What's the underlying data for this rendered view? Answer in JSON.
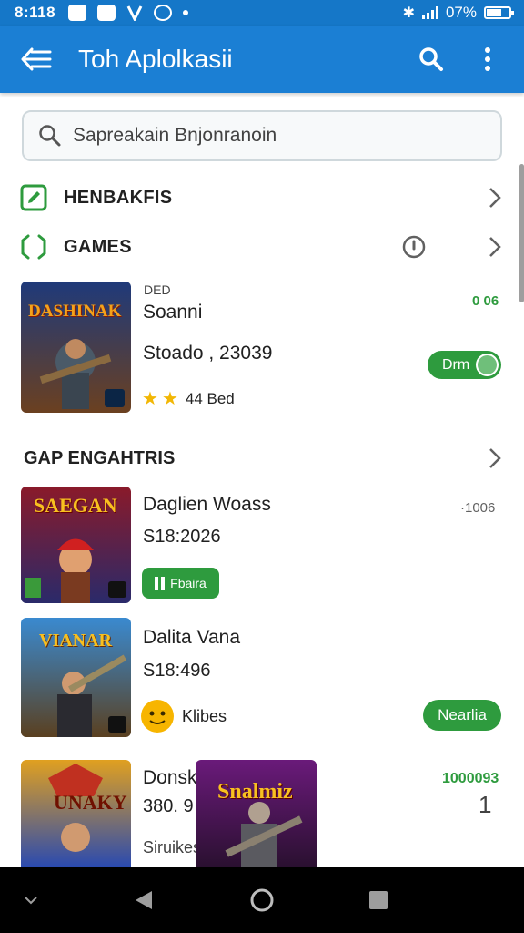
{
  "status_bar": {
    "time": "8:118",
    "battery": "07%"
  },
  "app_bar": {
    "title": "Toh Aplolkasii"
  },
  "search": {
    "placeholder": "Sapreakain Bnjonranoin"
  },
  "categories": [
    {
      "label": "HENBAKFIS"
    },
    {
      "label": "GAMES"
    }
  ],
  "featured": {
    "tag": "DED",
    "name": "Soanni",
    "meta": "Stoado , 23039",
    "rating": "44 Bed",
    "side_value": "0 06",
    "toggle_label": "Drm",
    "thumb_text": "DASHINAK"
  },
  "section": {
    "heading": "GAP ENGAHTRIS"
  },
  "apps": [
    {
      "name": "Daglien Woass",
      "meta": "S18:2026",
      "button": "Fbaira",
      "side": "·1006",
      "thumb_text": "SAEGAN"
    },
    {
      "name": "Dalita Vana",
      "meta": "S18:496",
      "reviewer": "Klibes",
      "button": "Nearlia",
      "thumb_text": "VIANAR"
    },
    {
      "name": "Donsk",
      "meta": "380. 9",
      "footer": "Siruikes",
      "side": "1000093",
      "count": "1",
      "thumb_text": "UNAKY"
    }
  ],
  "overlay_thumb": {
    "text": "Snalmiz"
  },
  "colors": {
    "primary": "#1b7fd4",
    "status_bar": "#1577c8",
    "green": "#2e9b3e",
    "navbar": "#000000"
  }
}
